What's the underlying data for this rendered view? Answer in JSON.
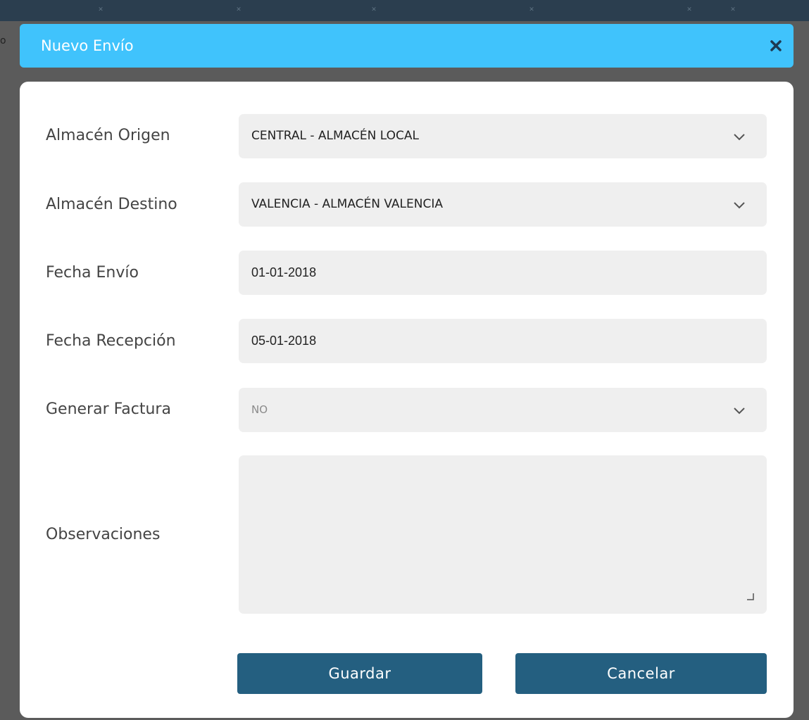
{
  "background": {
    "side_letter": "o"
  },
  "modal": {
    "title": "Nuevo Envío",
    "header_color": "#40c3fc",
    "close_icon": "close-icon"
  },
  "form": {
    "almacen_origen": {
      "label": "Almacén Origen",
      "value": "CENTRAL - ALMACÉN LOCAL"
    },
    "almacen_destino": {
      "label": "Almacén Destino",
      "value": "VALENCIA - ALMACÉN VALENCIA"
    },
    "fecha_envio": {
      "label": "Fecha Envío",
      "value": "01-01-2018"
    },
    "fecha_recepcion": {
      "label": "Fecha Recepción",
      "value": "05-01-2018"
    },
    "generar_factura": {
      "label": "Generar Factura",
      "value": "NO"
    },
    "observaciones": {
      "label": "Observaciones",
      "value": ""
    }
  },
  "actions": {
    "save_label": "Guardar",
    "cancel_label": "Cancelar",
    "button_color": "#245f80"
  }
}
